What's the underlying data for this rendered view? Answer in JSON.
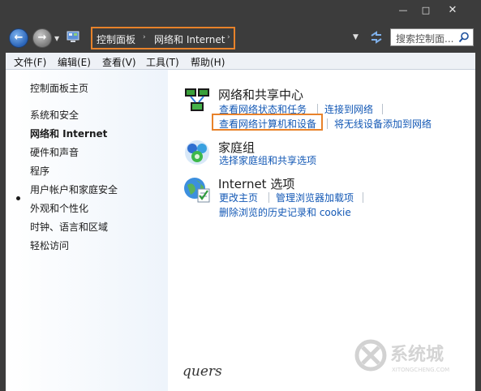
{
  "window": {
    "minimize_glyph": "—",
    "maximize_glyph": "□",
    "close_glyph": "✕"
  },
  "address": {
    "breadcrumbs": [
      "控制面板",
      "网络和 Internet"
    ],
    "separator": "›",
    "search_placeholder": "搜索控制面...",
    "highlight_color": "#e8822a"
  },
  "menu": {
    "items": [
      "文件(F)",
      "编辑(E)",
      "查看(V)",
      "工具(T)",
      "帮助(H)"
    ]
  },
  "sidebar": {
    "items": [
      {
        "label": "控制面板主页",
        "current": false
      },
      {
        "label": "系统和安全",
        "current": false
      },
      {
        "label": "网络和 Internet",
        "current": true
      },
      {
        "label": "硬件和声音",
        "current": false
      },
      {
        "label": "程序",
        "current": false
      },
      {
        "label": "用户帐户和家庭安全",
        "current": false
      },
      {
        "label": "外观和个性化",
        "current": false
      },
      {
        "label": "时钟、语言和区域",
        "current": false
      },
      {
        "label": "轻松访问",
        "current": false
      }
    ]
  },
  "main": {
    "categories": [
      {
        "title": "网络和共享中心",
        "icon": "network-sharing-icon",
        "links": [
          "查看网络状态和任务",
          "连接到网络",
          "查看网络计算机和设备",
          "将无线设备添加到网络"
        ]
      },
      {
        "title": "家庭组",
        "icon": "homegroup-icon",
        "links": [
          "选择家庭组和共享选项"
        ]
      },
      {
        "title": "Internet 选项",
        "icon": "internet-options-icon",
        "links": [
          "更改主页",
          "管理浏览器加载项",
          "删除浏览的历史记录和 cookie"
        ]
      }
    ],
    "highlighted_link": "查看网络计算机和设备"
  },
  "watermark": {
    "text": "系统城",
    "subtext": "XITONGCHENG.COM"
  },
  "signature": "quers"
}
